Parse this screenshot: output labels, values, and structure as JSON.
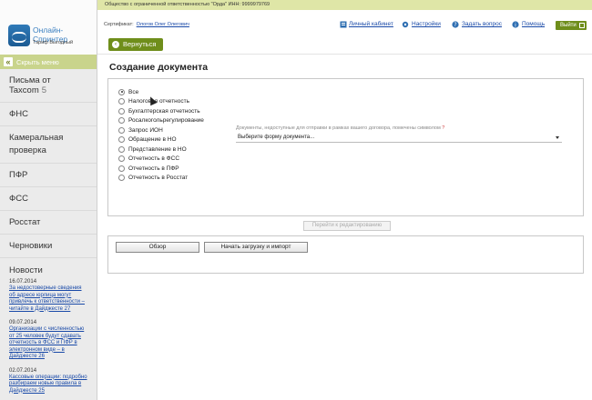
{
  "logo": {
    "title": "Онлайн-Спринтер",
    "tariff": "Тариф Выгодный"
  },
  "sidebar": {
    "hide_menu": "Скрыть меню",
    "items": [
      {
        "label": "Письма от Taxcom",
        "count": "5"
      },
      {
        "label": "ФНС"
      },
      {
        "label": "Камеральная проверка"
      },
      {
        "label": "ПФР"
      },
      {
        "label": "ФСС"
      },
      {
        "label": "Росстат"
      },
      {
        "label": "Черновики"
      }
    ],
    "news_title": "Новости",
    "news": [
      {
        "date": "16.07.2014",
        "text": "За недостоверные сведения об адресе юрлица могут привлечь к ответственности – читайте в Дайджесте 27"
      },
      {
        "date": "09.07.2014",
        "text": "Организации с численностью от 25 человек будут сдавать отчетность в ФСС и ПФР в электронном виде – в Дайджесте 26"
      },
      {
        "date": "02.07.2014",
        "text": "Кассовые операции: подробно разбираем новые правила в Дайджесте 25"
      }
    ]
  },
  "header": {
    "org": "Общество с ограниченной ответственностью \"Орда\" ИНН: 9999979769",
    "cert_label": "Сертификат:",
    "cert_name": "Ологов Олег Олегович",
    "links": {
      "cabinet": "Личный кабинет",
      "settings": "Настройки",
      "ask": "Задать вопрос",
      "help": "Помощь"
    },
    "exit": "Выйти"
  },
  "back_button": "Вернуться",
  "page_title": "Создание документа",
  "radios": [
    {
      "label": "Все",
      "checked": true
    },
    {
      "label": "Налоговая отчетность",
      "checked": false
    },
    {
      "label": "Бухгалтерская отчетность",
      "checked": false
    },
    {
      "label": "Росалкогольрегулирование",
      "checked": false
    },
    {
      "label": "Запрос ИОН",
      "checked": false
    },
    {
      "label": "Обращение в НО",
      "checked": false
    },
    {
      "label": "Представление в НО",
      "checked": false
    },
    {
      "label": "Отчетность в ФСС",
      "checked": false
    },
    {
      "label": "Отчетность в ПФР",
      "checked": false
    },
    {
      "label": "Отчетность в Росстат",
      "checked": false
    }
  ],
  "docs_note": "Документы, недоступные для отправки в рамках вашего договора, помечены символом",
  "docs_note_mark": "?",
  "form_select": "Выберите форму документа...",
  "edit_button": "Перейти к редактированию",
  "browse_button": "Обзор",
  "import_button": "Начать загрузку и импорт",
  "colors": {
    "accent": "#6f8e1b",
    "org_bar": "#dfe6a7",
    "hide_menu": "#c9d48c",
    "link": "#1a4aa8"
  },
  "icons": [
    "cabinet-icon",
    "gear-icon",
    "question-icon",
    "info-icon",
    "exit-icon",
    "back-arrow-icon",
    "double-chevron-left-icon"
  ]
}
